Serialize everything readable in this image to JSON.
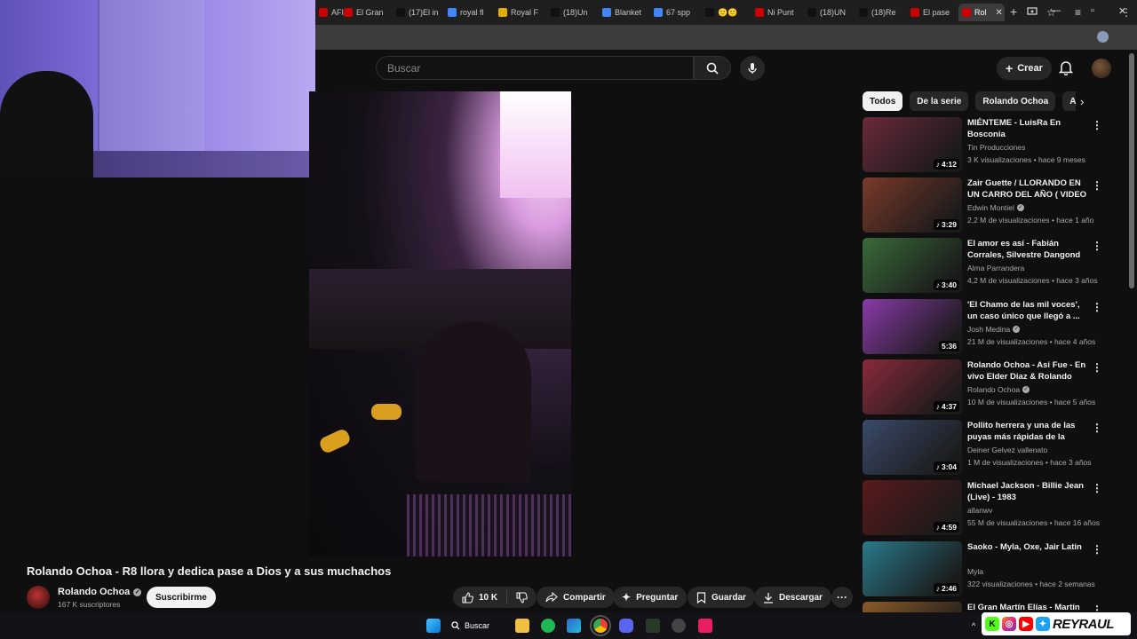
{
  "browser": {
    "tabs": [
      {
        "label": "AFIC",
        "favicon_color": "#cc0000"
      },
      {
        "label": "El Gran",
        "favicon_color": "#cc0000"
      },
      {
        "label": "(17)El in",
        "favicon_color": "#111111"
      },
      {
        "label": "royal fl",
        "favicon_color": "#4285f4"
      },
      {
        "label": "Royal F",
        "favicon_color": "#e0b000"
      },
      {
        "label": "(18)Un",
        "favicon_color": "#111111"
      },
      {
        "label": "Blanket",
        "favicon_color": "#4285f4"
      },
      {
        "label": "67 spp",
        "favicon_color": "#4285f4"
      },
      {
        "label": "🙂🙂",
        "favicon_color": "#111111"
      },
      {
        "label": "Ni Punt",
        "favicon_color": "#cc0000"
      },
      {
        "label": "(18)UN",
        "favicon_color": "#111111"
      },
      {
        "label": "(18)Re",
        "favicon_color": "#111111"
      },
      {
        "label": "El pase",
        "favicon_color": "#cc0000"
      },
      {
        "label": "Rol",
        "favicon_color": "#cc0000"
      }
    ],
    "new_tab_symbol": "+"
  },
  "youtube": {
    "search_placeholder": "Buscar",
    "create_label": "Crear",
    "video": {
      "title": "Rolando Ochoa - R8 llora y dedica pase a Dios y a sus muchachos",
      "channel": "Rolando Ochoa",
      "subscribers": "167 K suscriptores",
      "subscribe_label": "Suscribirme",
      "likes": "10 K",
      "share_label": "Compartir",
      "ask_label": "Preguntar",
      "save_label": "Guardar",
      "download_label": "Descargar",
      "more_symbol": "···"
    },
    "chips": [
      "Todos",
      "De la serie",
      "Rolando Ochoa",
      "Acordeón"
    ],
    "recommendations": [
      {
        "title": "MIÉNTEME - LuisRa En Bosconia",
        "channel": "Tin Producciones",
        "verified": false,
        "meta": "3 K visualizaciones • hace 9 meses",
        "duration": "4:12",
        "music": true,
        "thumb": "#6a2a3a"
      },
      {
        "title": "Zair Guette / LLORANDO EN UN CARRO DEL AÑO ( VIDEO ...",
        "channel": "Edwin Montiel",
        "verified": true,
        "meta": "2,2 M de visualizaciones • hace 1 año",
        "duration": "3:29",
        "music": true,
        "thumb": "#7a3a2a"
      },
      {
        "title": "El amor es así - Fabián Corrales, Silvestre Dangond y José L ...",
        "channel": "Alma Parrandera",
        "verified": false,
        "meta": "4,2 M de visualizaciones • hace 3 años",
        "duration": "3:40",
        "music": true,
        "thumb": "#3a6a3a"
      },
      {
        "title": "'El Chamo de las mil voces', un caso único que llegó a ...",
        "channel": "Josh Medina",
        "verified": true,
        "meta": "21 M de visualizaciones • hace 4 años",
        "duration": "5:36",
        "music": false,
        "thumb": "#8a3aa8"
      },
      {
        "title": "Rolando Ochoa - Asi Fue - En vivo Elder Diaz & Rolando Ocha",
        "channel": "Rolando Ochoa",
        "verified": true,
        "meta": "10 M de visualizaciones • hace 5 años",
        "duration": "4:37",
        "music": true,
        "thumb": "#8a2a3a"
      },
      {
        "title": "Pollito herrera y una de las puyas más rápidas de la histor...",
        "channel": "Deiner Gelvez vallenato",
        "verified": false,
        "meta": "1 M de visualizaciones • hace 3 años",
        "duration": "3:04",
        "music": true,
        "thumb": "#3a4a6a"
      },
      {
        "title": "Michael Jackson - Billie Jean (Live) - 1983",
        "channel": "allanwv",
        "verified": false,
        "meta": "55 M de visualizaciones • hace 16 años",
        "duration": "4:59",
        "music": true,
        "thumb": "#5a1a1a"
      },
      {
        "title": "Saoko - Myla, Oxe, Jair Latin",
        "channel": "Myla",
        "verified": false,
        "meta": "322 visualizaciones • hace 2 semanas",
        "duration": "2:46",
        "music": true,
        "thumb": "#2a7a8a"
      },
      {
        "title": "El Gran Martín Elías - Martín",
        "channel": "",
        "verified": false,
        "meta": "",
        "duration": "",
        "music": false,
        "thumb": "#8a5a2a"
      }
    ]
  },
  "taskbar": {
    "search_label": "Buscar",
    "brand_name": "REYRAUL"
  }
}
